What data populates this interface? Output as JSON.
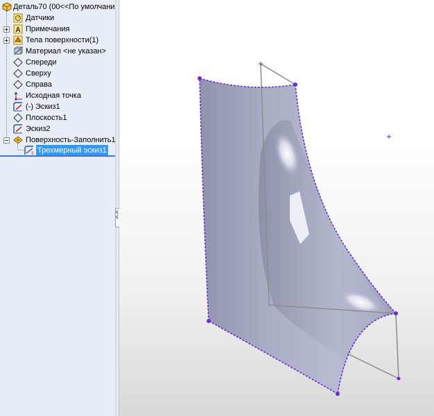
{
  "feature_tree": {
    "root_label": "Деталь70  (00<<По умолчанию",
    "items": [
      {
        "label": "Датчики",
        "icon": "sensors-icon"
      },
      {
        "label": "Примечания",
        "icon": "annotations-icon"
      },
      {
        "label": "Тела поверхности(1)",
        "icon": "surface-bodies-icon"
      },
      {
        "label": "Материал <не указан>",
        "icon": "material-icon"
      },
      {
        "label": "Спереди",
        "icon": "plane-icon"
      },
      {
        "label": "Сверху",
        "icon": "plane-icon"
      },
      {
        "label": "Справа",
        "icon": "plane-icon"
      },
      {
        "label": "Исходная точка",
        "icon": "origin-icon"
      },
      {
        "label": "(-) Эскиз1",
        "icon": "sketch-icon"
      },
      {
        "label": "Плоскость1",
        "icon": "plane-icon"
      },
      {
        "label": "Эскиз2",
        "icon": "sketch-icon"
      },
      {
        "label": "Поверхность-Заполнить1",
        "icon": "surface-fill-icon"
      },
      {
        "label": "Трехмерный эскиз1",
        "icon": "3d-sketch-icon",
        "selected": true
      }
    ]
  },
  "colors": {
    "tree_background": "#e8eef7",
    "selection": "#3399ff",
    "surface_edge": "#6a2bd8",
    "surface_fill": "#a7abc3"
  }
}
